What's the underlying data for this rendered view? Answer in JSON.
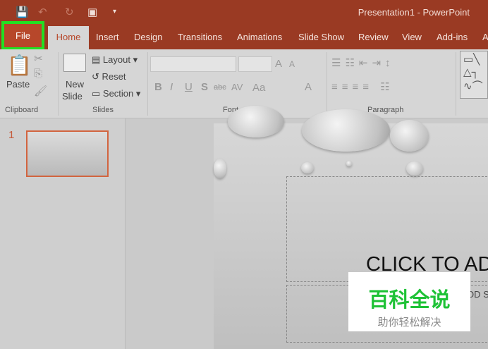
{
  "window": {
    "title": "Presentation1  -  PowerPoint"
  },
  "quick_access": {
    "save": "save-icon",
    "undo": "undo-icon",
    "redo": "redo-icon",
    "present": "present-icon",
    "customize": "▾"
  },
  "tabs": [
    "File",
    "Home",
    "Insert",
    "Design",
    "Transitions",
    "Animations",
    "Slide Show",
    "Review",
    "View",
    "Add-ins",
    "A"
  ],
  "ribbon": {
    "clipboard": {
      "paste": "Paste",
      "label": "Clipboard"
    },
    "slides": {
      "new_slide_line1": "New",
      "new_slide_line2": "Slide",
      "layout": "Layout",
      "reset": "Reset",
      "section": "Section",
      "label": "Slides"
    },
    "font": {
      "label": "Font",
      "bold": "B",
      "italic": "I",
      "underline": "U",
      "shadow": "S",
      "strike": "abc",
      "spacing": "AV",
      "case": "Aa",
      "grow": "A",
      "shrink": "A",
      "color": "A"
    },
    "paragraph": {
      "label": "Paragraph"
    }
  },
  "slide_panel": {
    "slide_number": "1"
  },
  "slide": {
    "title_placeholder": "CLICK TO AD",
    "subtitle_placeholder": "OD S"
  },
  "watermark": {
    "title": "百科全说",
    "subtitle": "助你轻松解决"
  },
  "colors": {
    "accent": "#9a3a23",
    "highlight": "#22e022",
    "watermark_green": "#1ec236"
  }
}
